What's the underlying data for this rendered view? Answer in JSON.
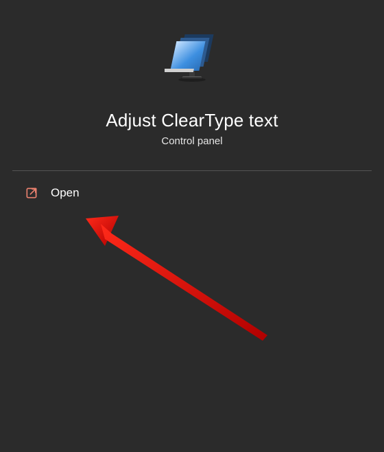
{
  "header": {
    "title": "Adjust ClearType text",
    "subtitle": "Control panel",
    "icon_name": "monitor-icon"
  },
  "action": {
    "open_label": "Open",
    "icon_name": "external-link-icon"
  },
  "colors": {
    "accent": "#e9806e",
    "arrow": "#e11b1b"
  }
}
